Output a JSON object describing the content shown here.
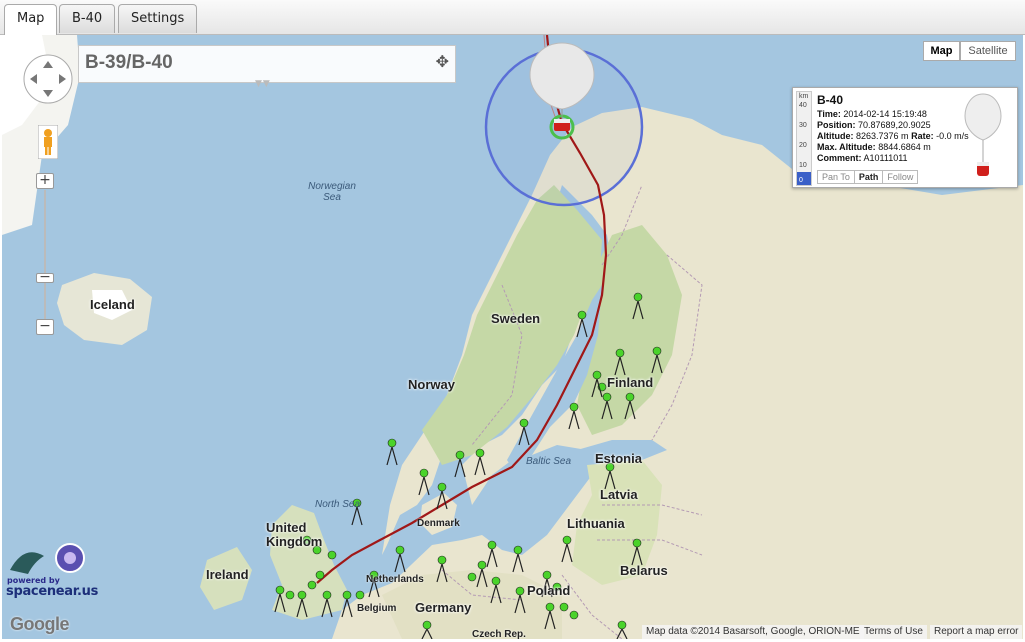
{
  "tabs": [
    "Map",
    "B-40",
    "Settings"
  ],
  "header": {
    "title": "B-39/B-40"
  },
  "map_type": {
    "map": "Map",
    "satellite": "Satellite"
  },
  "info": {
    "title": "B-40",
    "time_label": "Time:",
    "time": "2014-02-14 15:19:48",
    "position_label": "Position:",
    "position": "70.87689,20.9025",
    "altitude_label": "Altitude:",
    "altitude": "8263.7376 m",
    "rate_label": "Rate:",
    "rate": "-0.0 m/s",
    "max_altitude_label": "Max. Altitude:",
    "max_altitude": "8844.6864 m",
    "comment_label": "Comment:",
    "comment": "A10111011",
    "buttons": [
      "Pan To",
      "Path",
      "Follow"
    ],
    "gauge_ticks": [
      "km",
      "40",
      "30",
      "20",
      "10",
      "0"
    ],
    "gauge_level_km": 8.26
  },
  "places": {
    "countries": [
      "Iceland",
      "Sweden",
      "Norway",
      "Finland",
      "Estonia",
      "Latvia",
      "Lithuania",
      "Belarus",
      "United Kingdom",
      "Ireland",
      "Germany",
      "Poland",
      "Czech Rep."
    ],
    "seas": [
      "Norwegian Sea",
      "Baltic Sea",
      "North Sea"
    ],
    "small": [
      "Denmark",
      "Netherlands",
      "Belgium"
    ]
  },
  "branding": {
    "powered": "powered by",
    "site": "spacenear.us",
    "google": "Google"
  },
  "attribution": {
    "data": "Map data ©2014 Basarsoft, Google, ORION-ME",
    "terms": "Terms of Use",
    "report": "Report a map error"
  },
  "zoom": {
    "plus": "+",
    "minus": "−"
  },
  "colors": {
    "track": "#a01818",
    "water": "#a4c6e0",
    "land": "#e9e5cf",
    "forest": "#c5d8a6",
    "range_circle": "#5a6fd6"
  }
}
